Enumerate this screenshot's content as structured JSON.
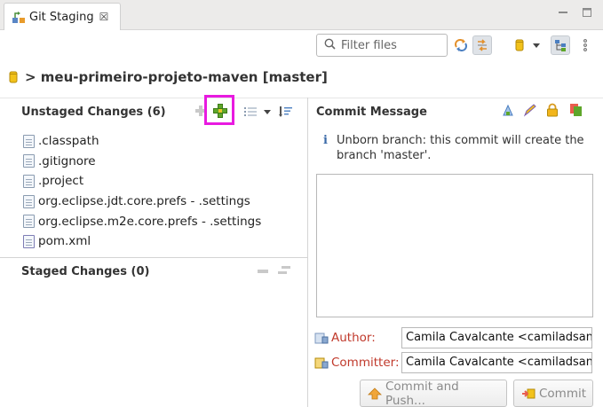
{
  "tab": {
    "title": "Git Staging",
    "close": "☒"
  },
  "window": {
    "minimize": "▭",
    "maximize": "▭",
    "menu": "⋮"
  },
  "toolbar": {
    "filter_placeholder": "Filter files"
  },
  "repo": {
    "title": "> meu-primeiro-projeto-maven [master]"
  },
  "unstaged": {
    "title": "Unstaged Changes (6)",
    "files": [
      ".classpath",
      ".gitignore",
      ".project",
      "org.eclipse.jdt.core.prefs - .settings",
      "org.eclipse.m2e.core.prefs - .settings",
      "pom.xml"
    ]
  },
  "staged": {
    "title": "Staged Changes (0)"
  },
  "commit": {
    "title": "Commit Message",
    "info": "Unborn branch: this commit will create the branch 'master'.",
    "message": "",
    "author_label": "Author:",
    "author_value": "Camila Cavalcante <camiladsan",
    "committer_label": "Committer:",
    "committer_value": "Camila Cavalcante <camiladsan",
    "commit_push_label": "Commit and Push...",
    "commit_label": "Commit"
  },
  "colors": {
    "highlight": "#e81ae0",
    "label_red": "#c0392b",
    "add_green": "#5ea62a"
  }
}
